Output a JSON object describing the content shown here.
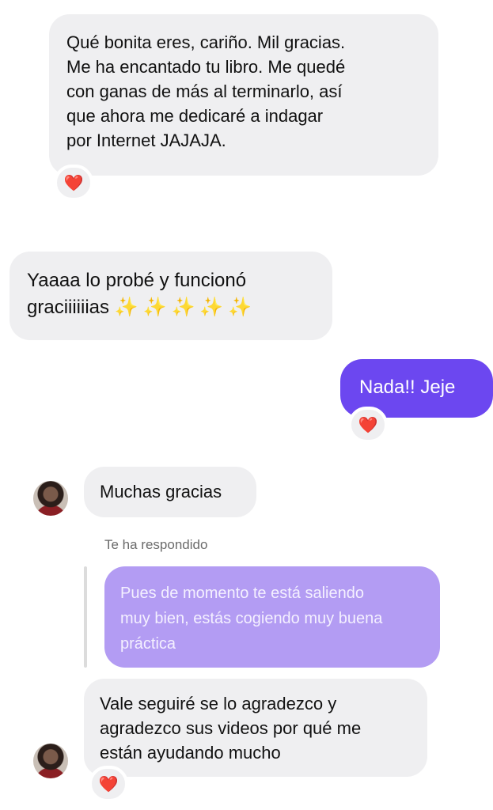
{
  "messages": {
    "m1": {
      "lines": [
        "Qué bonita eres, cariño. Mil gracias.",
        "Me ha encantado tu libro. Me quedé",
        "con ganas de más al terminarlo, así",
        "que ahora me dedicaré a indagar",
        "por Internet JAJAJA."
      ],
      "reaction": "❤️"
    },
    "m2": {
      "lines": [
        "Yaaaa lo probé y funcionó"
      ],
      "line2_text": "graciiiiiias",
      "line2_emoji": "✨✨✨✨✨"
    },
    "m3": {
      "text": "Nada!! Jeje",
      "reaction": "❤️"
    },
    "m4": {
      "text": "Muchas gracias"
    },
    "reply_label": "Te ha respondido",
    "reply_quote": {
      "lines": [
        "Pues de momento te está saliendo",
        "muy bien, estás cogiendo muy buena",
        "práctica"
      ]
    },
    "m5": {
      "lines": [
        "Vale seguiré se lo agradezco y",
        "agradezco sus videos por qué me",
        "están ayudando mucho"
      ],
      "reaction": "❤️"
    }
  },
  "colors": {
    "sent_bubble": "#6c47f0",
    "received_bubble": "#efeff1",
    "reply_bubble": "#b39cf3"
  }
}
